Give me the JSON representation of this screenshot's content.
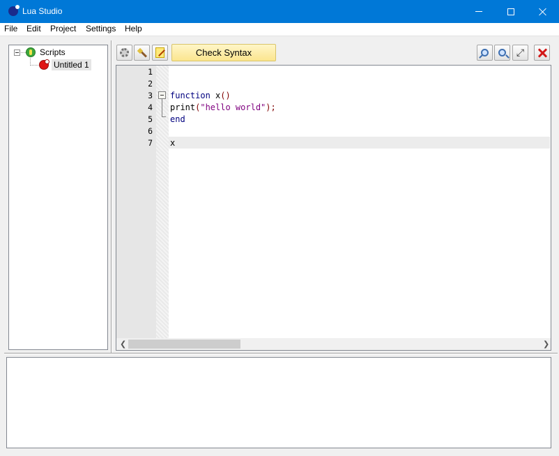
{
  "window": {
    "title": "Lua Studio",
    "accent_color": "#0078d7",
    "icon": "lua-studio-app-icon"
  },
  "menu": {
    "items": [
      "File",
      "Edit",
      "Project",
      "Settings",
      "Help"
    ]
  },
  "tree": {
    "root_label": "Scripts",
    "root_icon": "scripts-folder-icon",
    "children": [
      {
        "label": "Untitled 1",
        "icon": "lua-file-icon",
        "selected": true
      }
    ]
  },
  "toolbar": {
    "left_icons": [
      "gear-icon",
      "magic-wand-icon",
      "edit-icon"
    ],
    "check_syntax_label": "Check Syntax",
    "right_icons": [
      "find-icon",
      "zoom-icon",
      "fullscreen-icon",
      "stop-icon"
    ]
  },
  "editor": {
    "line_numbers": [
      "1",
      "2",
      "3",
      "4",
      "5",
      "6",
      "7"
    ],
    "current_line": "7",
    "code": {
      "line3": {
        "kw": "function",
        "name": " x",
        "op": "()"
      },
      "line4": {
        "fn": "print",
        "op_open": "(",
        "str": "\"hello world\"",
        "op_close": ");"
      },
      "line5": {
        "kw": "end"
      },
      "line7": {
        "text": "x"
      }
    },
    "colors": {
      "keyword": "#00007f",
      "string": "#7f007f",
      "operator": "#7f0000"
    }
  },
  "output": {
    "text": ""
  }
}
